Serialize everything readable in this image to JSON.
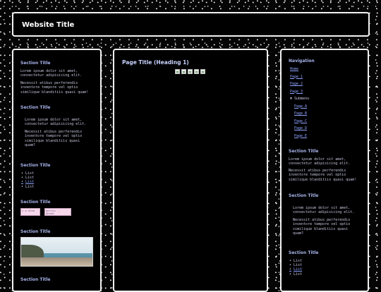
{
  "site": {
    "title": "Website Title"
  },
  "left": {
    "s1": {
      "title": "Section Title",
      "p1": "Lorem ipsum dolor sit amet,\nconsectetur adipisicing elit.",
      "p2": "Necessit atibus perferendis\ninventore tempore vel optio\nsimilique blanditiis quasi quam!"
    },
    "s2": {
      "title": "Section Title",
      "p1": "Lorem ipsum dolor sit amet,\nconsectetur adipisicing elit.",
      "p2": "Necessit atibus perferendis\ninventore tempore vel optio\nsimilique blanditiis quasi\nquam?"
    },
    "s3": {
      "title": "Section Title",
      "items": [
        "List",
        "List",
        "List",
        "List"
      ]
    },
    "s4": {
      "title": "Section Title",
      "badge1": "n-o ahed",
      "badge2": "gerico -- ahead"
    },
    "s5": {
      "title": "Section Title"
    },
    "s6": {
      "title": "Section Title"
    }
  },
  "main": {
    "title": "Page Title (Heading 1)"
  },
  "right": {
    "nav": {
      "title": "Navigation",
      "home": "Home",
      "page1": "Page 1",
      "page2": "Page 2",
      "page3": "Page 3",
      "submenu": "▼ Submenu",
      "pageA": "Page A",
      "pageB": "Page B",
      "pageC": "Page C",
      "pageD": "Page D",
      "pageE": "Page E"
    },
    "s1": {
      "title": "Section Title",
      "p1": "Lorem ipsum dolor sit amet,\nconsectetur adipisicing elit.",
      "p2": "Necessit atibus perferendis\ninventore tempore vel optio\nsimilique blanditiis quasi quam!"
    },
    "s2": {
      "title": "Section Title",
      "p1": "Lorem ipsum dolor sit amet,\nconsectetur adipisicing elit.",
      "p2": "Necessit atibus perferendis\ninventore tempore vel optio\nsimilique blanditiis quasi\nquam?"
    },
    "s3": {
      "title": "Section Title",
      "items": [
        "List",
        "List",
        "List",
        "List"
      ]
    }
  }
}
